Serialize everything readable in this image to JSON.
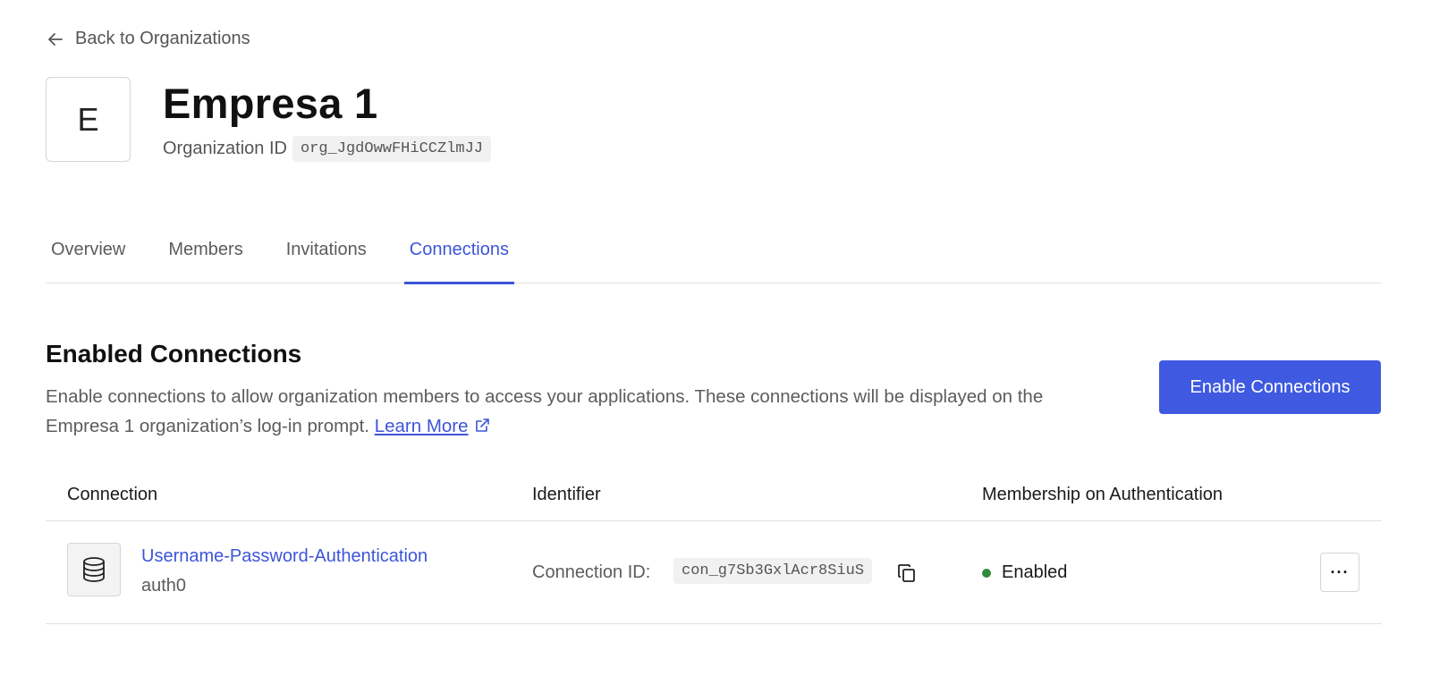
{
  "nav": {
    "back_label": "Back to Organizations"
  },
  "org": {
    "avatar_letter": "E",
    "name": "Empresa 1",
    "id_label": "Organization ID",
    "id_value": "org_JgdOwwFHiCCZlmJJ"
  },
  "tabs": [
    {
      "label": "Overview",
      "active": false
    },
    {
      "label": "Members",
      "active": false
    },
    {
      "label": "Invitations",
      "active": false
    },
    {
      "label": "Connections",
      "active": true
    }
  ],
  "section": {
    "title": "Enabled Connections",
    "description": "Enable connections to allow organization members to access your applications. These connections will be displayed on the Empresa 1 organization’s log-in prompt.",
    "learn_more": "Learn More",
    "enable_button": "Enable Connections"
  },
  "table": {
    "headers": {
      "connection": "Connection",
      "identifier": "Identifier",
      "membership": "Membership on Authentication"
    },
    "rows": [
      {
        "name": "Username-Password-Authentication",
        "strategy": "auth0",
        "id_label": "Connection ID:",
        "id_value": "con_g7Sb3GxlAcr8SiuS",
        "status": "Enabled",
        "more_label": "···"
      }
    ]
  },
  "colors": {
    "accent": "#3d55d8",
    "button": "#3f59e0",
    "status_enabled": "#2f8a3e"
  },
  "icons": {
    "back": "arrow-left-icon",
    "database": "database-icon",
    "external": "external-link-icon",
    "copy": "copy-icon",
    "more": "more-horizontal-icon"
  }
}
